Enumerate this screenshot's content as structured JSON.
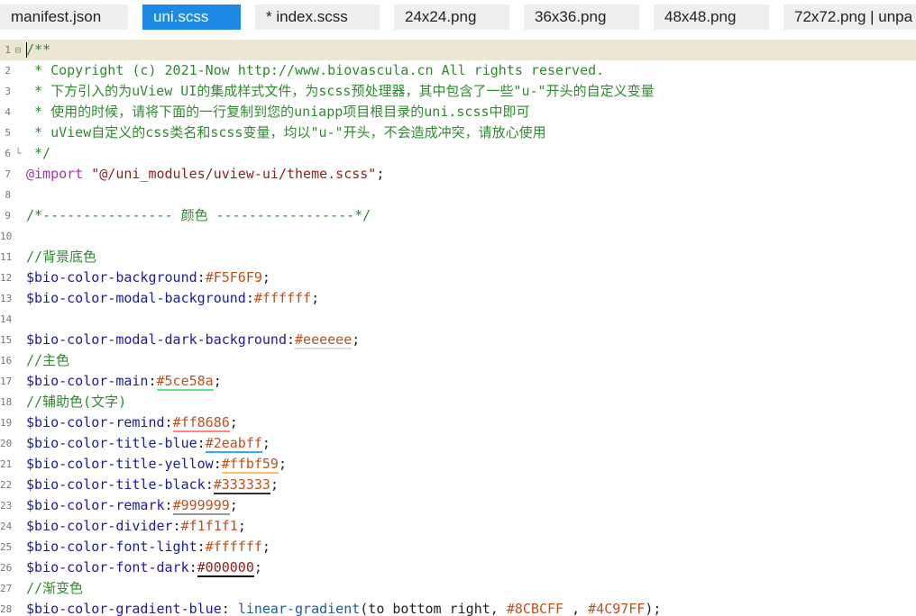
{
  "tabs": [
    {
      "label": "manifest.json",
      "active": false
    },
    {
      "label": "uni.scss",
      "active": true
    },
    {
      "label": "* index.scss",
      "active": false
    },
    {
      "label": "24x24.png",
      "active": false
    },
    {
      "label": "36x36.png",
      "active": false
    },
    {
      "label": "48x48.png",
      "active": false
    },
    {
      "label": "72x72.png | unpa",
      "active": false
    }
  ],
  "editor": {
    "lines": [
      {
        "n": "1",
        "fold": "⊟",
        "parts": [
          {
            "t": "/**",
            "c": "comment"
          }
        ]
      },
      {
        "n": "2",
        "fold": "",
        "parts": [
          {
            "t": " * Copyright (c) 2021-Now http://www.biovascula.cn All rights reserved.",
            "c": "comment"
          }
        ]
      },
      {
        "n": "3",
        "fold": "",
        "parts": [
          {
            "t": " * 下方引入的为uView UI的集成样式文件，为scss预处理器，其中包含了一些\"u-\"开头的自定义变量",
            "c": "comment"
          }
        ]
      },
      {
        "n": "4",
        "fold": "",
        "parts": [
          {
            "t": " * 使用的时候，请将下面的一行复制到您的uniapp项目根目录的uni.scss中即可",
            "c": "comment"
          }
        ]
      },
      {
        "n": "5",
        "fold": "",
        "parts": [
          {
            "t": " * uView自定义的css类名和scss变量，均以\"u-\"开头，不会造成冲突，请放心使用",
            "c": "comment"
          }
        ]
      },
      {
        "n": "6",
        "fold": "└",
        "parts": [
          {
            "t": " */",
            "c": "comment"
          }
        ]
      },
      {
        "n": "7",
        "fold": "",
        "parts": [
          {
            "t": "@import ",
            "c": "kw"
          },
          {
            "t": "\"@/uni_modules/uview-ui/theme.scss\"",
            "c": "str"
          },
          {
            "t": ";",
            "c": "plain"
          }
        ]
      },
      {
        "n": "8",
        "fold": "",
        "parts": []
      },
      {
        "n": "9",
        "fold": "",
        "parts": [
          {
            "t": "/*---------------- 颜色 -----------------*/",
            "c": "comment"
          }
        ]
      },
      {
        "n": "10",
        "fold": "",
        "parts": []
      },
      {
        "n": "11",
        "fold": "",
        "parts": [
          {
            "t": "//背景底色",
            "c": "comment"
          }
        ]
      },
      {
        "n": "12",
        "fold": "",
        "parts": [
          {
            "t": "$bio-color-background",
            "c": "var"
          },
          {
            "t": ":",
            "c": "plain"
          },
          {
            "t": "#F5F6F9",
            "c": "val"
          },
          {
            "t": ";",
            "c": "plain"
          }
        ]
      },
      {
        "n": "13",
        "fold": "",
        "parts": [
          {
            "t": "$bio-color-modal-background",
            "c": "var"
          },
          {
            "t": ":",
            "c": "plain"
          },
          {
            "t": "#ffffff",
            "c": "val"
          },
          {
            "t": ";",
            "c": "plain"
          }
        ]
      },
      {
        "n": "14",
        "fold": "",
        "parts": []
      },
      {
        "n": "15",
        "fold": "",
        "parts": [
          {
            "t": "$bio-color-modal-dark-background",
            "c": "var"
          },
          {
            "t": ":",
            "c": "plain"
          },
          {
            "t": "#eeeeee",
            "c": "val",
            "u": "#dddddd"
          },
          {
            "t": ";",
            "c": "plain"
          }
        ]
      },
      {
        "n": "16",
        "fold": "",
        "parts": [
          {
            "t": "//主色",
            "c": "comment"
          }
        ]
      },
      {
        "n": "17",
        "fold": "",
        "parts": [
          {
            "t": "$bio-color-main",
            "c": "var"
          },
          {
            "t": ":",
            "c": "plain"
          },
          {
            "t": "#5ce58a",
            "c": "val",
            "u": "#5ce58a"
          },
          {
            "t": ";",
            "c": "plain"
          }
        ]
      },
      {
        "n": "18",
        "fold": "",
        "parts": [
          {
            "t": "//辅助色(文字)",
            "c": "comment"
          }
        ]
      },
      {
        "n": "19",
        "fold": "",
        "parts": [
          {
            "t": "$bio-color-remind",
            "c": "var"
          },
          {
            "t": ":",
            "c": "plain"
          },
          {
            "t": "#ff8686",
            "c": "val",
            "u": "#ff8686"
          },
          {
            "t": ";",
            "c": "plain"
          }
        ]
      },
      {
        "n": "20",
        "fold": "",
        "parts": [
          {
            "t": "$bio-color-title-blue",
            "c": "var"
          },
          {
            "t": ":",
            "c": "plain"
          },
          {
            "t": "#2eabff",
            "c": "val",
            "u": "#2eabff"
          },
          {
            "t": ";",
            "c": "plain"
          }
        ]
      },
      {
        "n": "21",
        "fold": "",
        "parts": [
          {
            "t": "$bio-color-title-yellow",
            "c": "var"
          },
          {
            "t": ":",
            "c": "plain"
          },
          {
            "t": "#ffbf59",
            "c": "val",
            "u": "#ffbf59"
          },
          {
            "t": ";",
            "c": "plain"
          }
        ]
      },
      {
        "n": "22",
        "fold": "",
        "parts": [
          {
            "t": "$bio-color-title-black",
            "c": "var"
          },
          {
            "t": ":",
            "c": "plain"
          },
          {
            "t": "#333333",
            "c": "val",
            "u": "#333333"
          },
          {
            "t": ";",
            "c": "plain"
          }
        ]
      },
      {
        "n": "23",
        "fold": "",
        "parts": [
          {
            "t": "$bio-color-remark",
            "c": "var"
          },
          {
            "t": ":",
            "c": "plain"
          },
          {
            "t": "#999999",
            "c": "val",
            "u": "#999999"
          },
          {
            "t": ";",
            "c": "plain"
          }
        ]
      },
      {
        "n": "24",
        "fold": "",
        "parts": [
          {
            "t": "$bio-color-divider",
            "c": "var"
          },
          {
            "t": ":",
            "c": "plain"
          },
          {
            "t": "#f1f1f1",
            "c": "val"
          },
          {
            "t": ";",
            "c": "plain"
          }
        ]
      },
      {
        "n": "25",
        "fold": "",
        "parts": [
          {
            "t": "$bio-color-font-light",
            "c": "var"
          },
          {
            "t": ":",
            "c": "plain"
          },
          {
            "t": "#ffffff",
            "c": "val"
          },
          {
            "t": ";",
            "c": "plain"
          }
        ]
      },
      {
        "n": "26",
        "fold": "",
        "parts": [
          {
            "t": "$bio-color-font-dark",
            "c": "var"
          },
          {
            "t": ":",
            "c": "plain"
          },
          {
            "t": "#000000",
            "c": "dark",
            "u": "#000000"
          },
          {
            "t": ";",
            "c": "plain"
          }
        ]
      },
      {
        "n": "27",
        "fold": "",
        "parts": [
          {
            "t": "//渐变色",
            "c": "comment"
          }
        ]
      },
      {
        "n": "28",
        "fold": "",
        "parts": [
          {
            "t": "$bio-color-gradient-blue",
            "c": "var"
          },
          {
            "t": ": ",
            "c": "plain"
          },
          {
            "t": "linear-gradient",
            "c": "fn"
          },
          {
            "t": "(to bottom right, ",
            "c": "plain"
          },
          {
            "t": "#8CBCFF",
            "c": "val"
          },
          {
            "t": " , ",
            "c": "plain"
          },
          {
            "t": "#4C97FF",
            "c": "val"
          },
          {
            "t": ");",
            "c": "plain"
          }
        ]
      }
    ]
  }
}
